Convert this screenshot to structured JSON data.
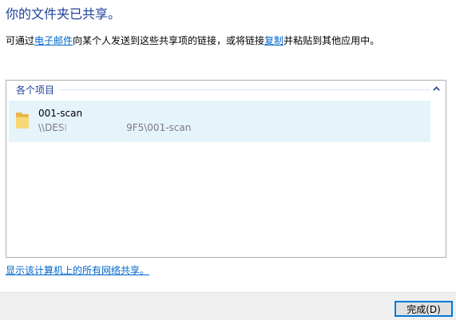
{
  "header": {
    "title": "你的文件夹已共享。"
  },
  "description": {
    "prefix": "可通过",
    "email_link": "电子邮件",
    "middle": "向某个人发送到这些共享项的链接，或将链接",
    "copy_link": "复制",
    "suffix": "并粘贴到其他应用中。"
  },
  "shared_items": {
    "group_label": "各个项目",
    "items": [
      {
        "name": "001-scan",
        "path_start": "\\\\DESI",
        "path_end": "9F5\\001-scan",
        "icon": "folder-icon"
      }
    ]
  },
  "links": {
    "show_all": "显示该计算机上的所有网络共享。"
  },
  "footer": {
    "done_label": "完成(D)"
  },
  "colors": {
    "title": "#1e3f9a",
    "link": "#0066cc",
    "item_selected_bg": "#e5f3fb",
    "button_border": "#0078d7",
    "folder": "#f8d775"
  }
}
